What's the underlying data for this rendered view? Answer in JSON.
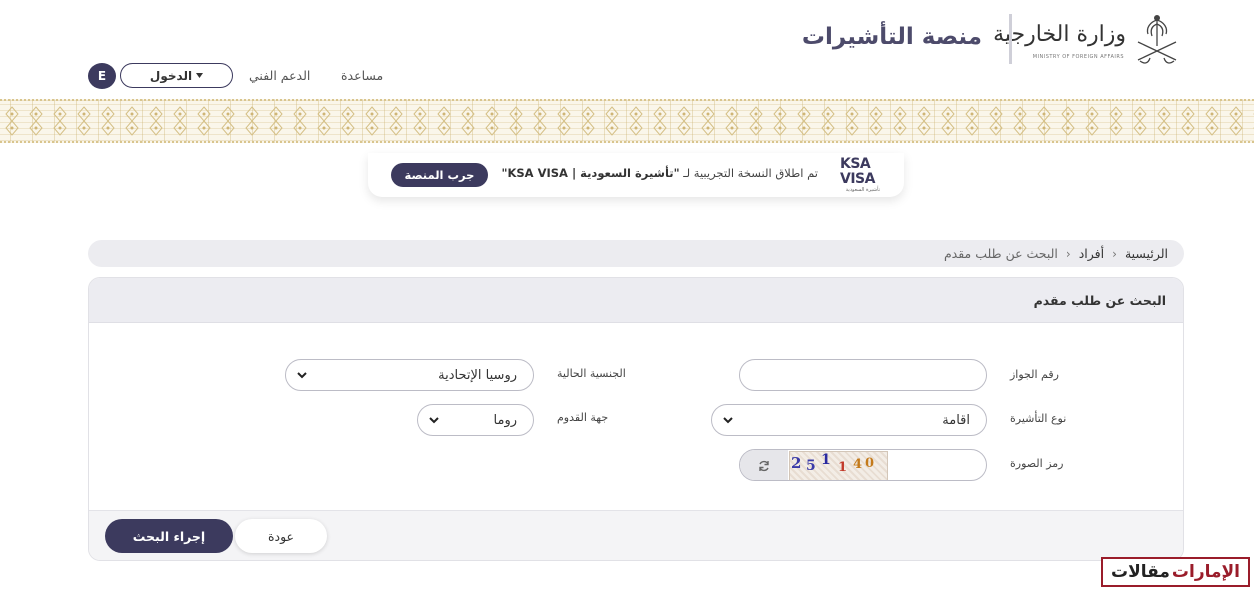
{
  "header": {
    "ministry_name_ar": "وزارة الخارجية",
    "ministry_name_en": "MINISTRY OF FOREIGN AFFAIRS",
    "platform_title": "منصة التأشيرات",
    "nav": {
      "help": "مساعدة",
      "tech_support": "الدعم الفني",
      "login": "الدخول",
      "language": "E"
    }
  },
  "announcement": {
    "text_prefix": "تم اطلاق النسخة التجريبية لـ ",
    "text_bold": "\"تأشيرة السعودية | KSA VISA\"",
    "button": "جرب المنصة",
    "logo_line1": "KSA",
    "logo_line2": "VISA",
    "logo_sub": "تأشيرة السعودية"
  },
  "breadcrumb": [
    "الرئيسية",
    "أفراد",
    "البحث عن طلب مقدم"
  ],
  "form": {
    "title": "البحث عن طلب مقدم",
    "passport_label": "رقم الجواز",
    "passport_value": "",
    "nationality_label": "الجنسية الحالية",
    "nationality_value": "روسيا الإتحادية",
    "visa_type_label": "نوع التأشيرة",
    "visa_type_value": "اقامة",
    "arrival_label": "جهة القدوم",
    "arrival_value": "روما",
    "captcha_label": "رمز الصورة",
    "captcha_value": "",
    "captcha_code": [
      "2",
      "5",
      "1",
      "1",
      "4",
      "0"
    ]
  },
  "actions": {
    "back": "عودة",
    "search": "إجراء البحث"
  },
  "watermark": {
    "part1": "مقالات",
    "part2": "الإمارات"
  },
  "colors": {
    "primary": "#3c3a5e",
    "title": "#4d4b6b",
    "pattern": "#faf6ea",
    "watermark_red": "#9a1c2a"
  }
}
